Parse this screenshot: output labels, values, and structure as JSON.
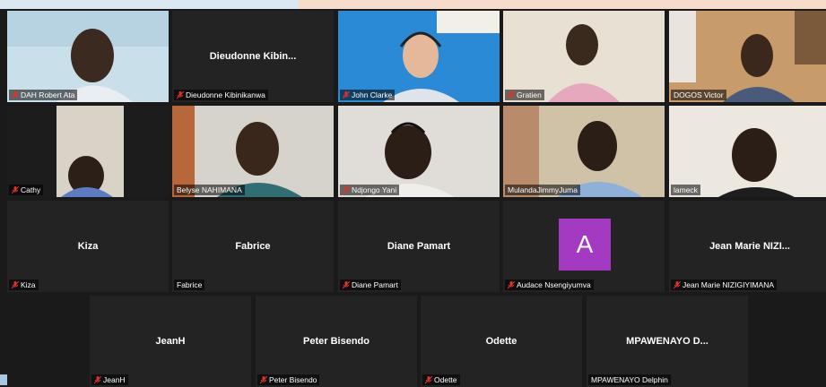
{
  "tiles": [
    {
      "id": "t0",
      "name": "DAH Robert Ata",
      "muted": true,
      "video": true
    },
    {
      "id": "t1",
      "name": "Dieudonne Kibinikanwa",
      "display": "Dieudonne  Kibin...",
      "muted": true,
      "video": false
    },
    {
      "id": "t2",
      "name": "John Clarke",
      "muted": true,
      "video": true
    },
    {
      "id": "t3",
      "name": "Gratien",
      "muted": true,
      "video": true
    },
    {
      "id": "t4",
      "name": "DOGOS Victor",
      "muted": false,
      "video": true
    },
    {
      "id": "t5",
      "name": "Cathy",
      "muted": true,
      "video": true
    },
    {
      "id": "t6",
      "name": "Belyse NAHIMANA",
      "muted": false,
      "video": true
    },
    {
      "id": "t7",
      "name": "Ndjongo Yani",
      "muted": true,
      "video": true
    },
    {
      "id": "t8",
      "name": "MulandaJimmyJuma",
      "muted": false,
      "video": true,
      "active": true
    },
    {
      "id": "t9",
      "name": "lameck",
      "muted": false,
      "video": true
    },
    {
      "id": "t10",
      "name": "Kiza",
      "display": "Kiza",
      "muted": true,
      "video": false
    },
    {
      "id": "t11",
      "name": "Fabrice",
      "display": "Fabrice",
      "muted": false,
      "video": false
    },
    {
      "id": "t12",
      "name": "Diane Pamart",
      "display": "Diane Pamart",
      "muted": true,
      "video": false
    },
    {
      "id": "t13",
      "name": "Audace Nsengiyumva",
      "avatar_letter": "A",
      "muted": true,
      "video": false
    },
    {
      "id": "t14",
      "name": "Jean Marie NIZIGIYIMANA",
      "display": "Jean Marie NIZI...",
      "muted": true,
      "video": false
    },
    {
      "id": "t15",
      "name": "JeanH",
      "display": "JeanH",
      "muted": true,
      "video": false
    },
    {
      "id": "t16",
      "name": "Peter Bisendo",
      "display": "Peter Bisendo",
      "muted": true,
      "video": false
    },
    {
      "id": "t17",
      "name": "Odette",
      "display": "Odette",
      "muted": true,
      "video": false
    },
    {
      "id": "t18",
      "name": "MPAWENAYO  Delphin",
      "display": "MPAWENAYO   D...",
      "muted": false,
      "video": false
    }
  ],
  "colors": {
    "active_border": "#c4e23a",
    "muted_icon": "#e0312b",
    "avatar_bg": "#a43ac1"
  }
}
